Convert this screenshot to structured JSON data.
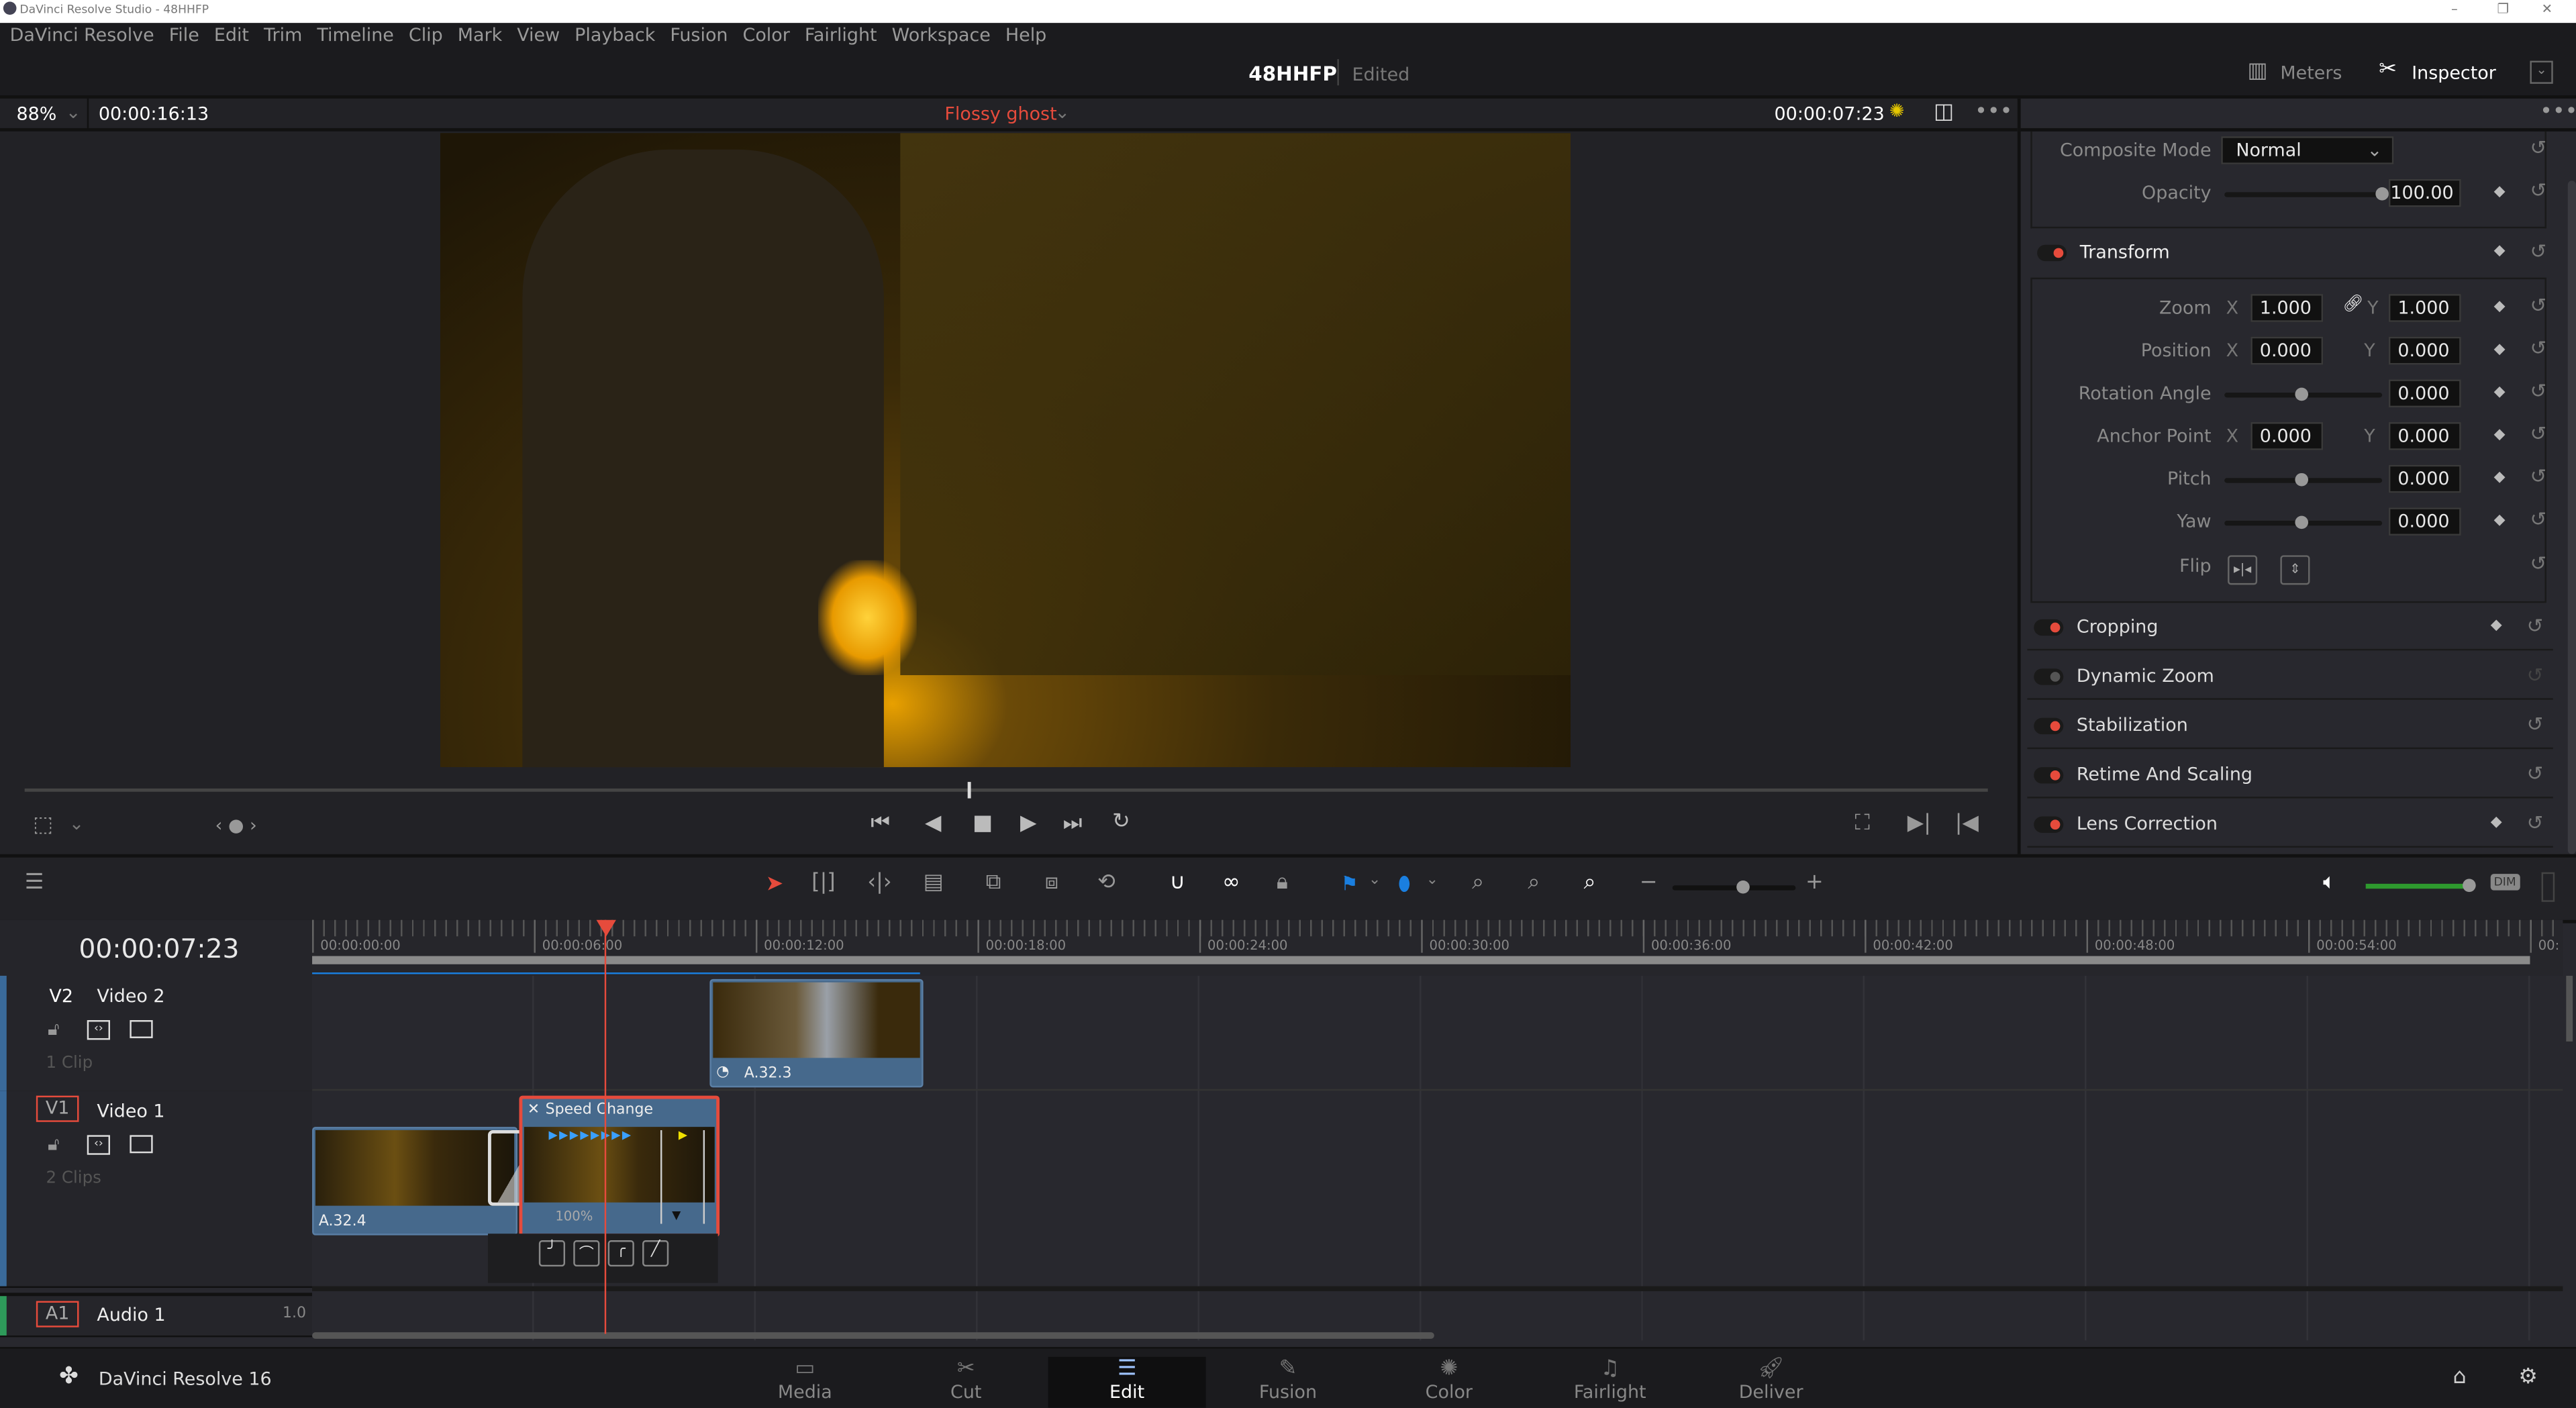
{
  "window": {
    "title": "DaVinci Resolve Studio - 48HHFP",
    "controls": [
      "–",
      "❐",
      "✕"
    ]
  },
  "menu": [
    "DaVinci Resolve",
    "File",
    "Edit",
    "Trim",
    "Timeline",
    "Clip",
    "Mark",
    "View",
    "Playback",
    "Fusion",
    "Color",
    "Fairlight",
    "Workspace",
    "Help"
  ],
  "header": {
    "project": "48HHFP",
    "status": "Edited",
    "meters": "Meters",
    "inspector": "Inspector"
  },
  "viewer": {
    "zoom": "88%",
    "duration": "00:00:16:13",
    "clip_name": "Flossy ghost",
    "timecode": "00:00:07:23",
    "scrub_progress": 0.48
  },
  "inspector": {
    "composite_mode_label": "Composite Mode",
    "composite_mode": "Normal",
    "opacity_label": "Opacity",
    "opacity": "100.00",
    "opacity_level": 1.0,
    "transform": "Transform",
    "zoom_label": "Zoom",
    "zoom_x": "1.000",
    "zoom_y": "1.000",
    "position_label": "Position",
    "position_x": "0.000",
    "position_y": "0.000",
    "rotation_label": "Rotation Angle",
    "rotation": "0.000",
    "anchor_label": "Anchor Point",
    "anchor_x": "0.000",
    "anchor_y": "0.000",
    "pitch_label": "Pitch",
    "pitch": "0.000",
    "yaw_label": "Yaw",
    "yaw": "0.000",
    "flip_label": "Flip",
    "x_label": "X",
    "y_label": "Y",
    "sections": [
      {
        "label": "Cropping",
        "on": true
      },
      {
        "label": "Dynamic Zoom",
        "on": false
      },
      {
        "label": "Stabilization",
        "on": true
      },
      {
        "label": "Retime And Scaling",
        "on": true
      },
      {
        "label": "Lens Correction",
        "on": true
      }
    ]
  },
  "timeline": {
    "timecode": "00:00:07:23",
    "ruler": [
      "00:00:00:00",
      "00:00:06:00",
      "00:00:12:00",
      "00:00:18:00",
      "00:00:24:00",
      "00:00:30:00",
      "00:00:36:00",
      "00:00:42:00",
      "00:00:48:00",
      "00:00:54:00",
      "00:"
    ],
    "dim": "DIM",
    "tracks": [
      {
        "id": "V2",
        "name": "Video 2",
        "count": "1 Clip"
      },
      {
        "id": "V1",
        "name": "Video 1",
        "count": "2 Clips"
      },
      {
        "id": "A1",
        "name": "Audio 1",
        "level": "1.0"
      }
    ],
    "clips": {
      "v2": "A.32.3",
      "v1": "A.32.4",
      "speed_title": "Speed Change",
      "speed_pct": "100%"
    }
  },
  "bottom": {
    "app": "DaVinci Resolve 16",
    "tabs": [
      "Media",
      "Cut",
      "Edit",
      "Fusion",
      "Color",
      "Fairlight",
      "Deliver"
    ],
    "active": "Edit"
  },
  "colors": {
    "accent_red": "#e64b3c",
    "clip_blue": "#46698c",
    "audio_green": "#2e9a2e",
    "marker_blue": "#1a7fe0"
  }
}
